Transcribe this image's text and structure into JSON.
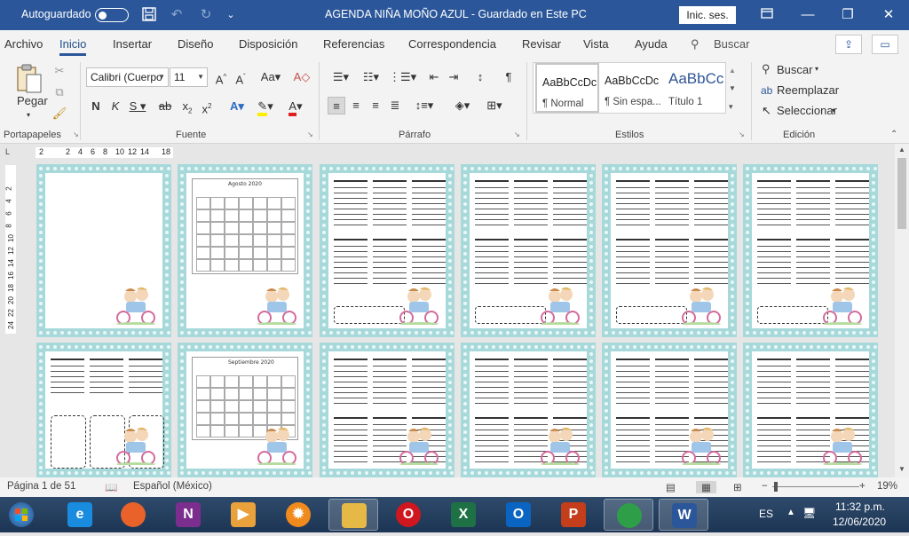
{
  "titlebar": {
    "autosave_label": "Autoguardado",
    "doc_title": "AGENDA NIÑA MOÑO AZUL  -  Guardado en Este PC",
    "signin": "Inic. ses.",
    "restore_icon": "ribbon-display-icon",
    "minimize": "—",
    "maximize": "❐",
    "close": "✕"
  },
  "menu": {
    "tabs": [
      "Archivo",
      "Inicio",
      "Insertar",
      "Diseño",
      "Disposición",
      "Referencias",
      "Correspondencia",
      "Revisar",
      "Vista",
      "Ayuda"
    ],
    "search_placeholder": "Buscar"
  },
  "ribbon": {
    "clipboard": {
      "paste": "Pegar",
      "label": "Portapapeles"
    },
    "font": {
      "family": "Calibri (Cuerpo",
      "size": "11",
      "label": "Fuente"
    },
    "paragraph": {
      "label": "Párrafo"
    },
    "styles": {
      "label": "Estilos",
      "items": [
        {
          "preview": "AaBbCcDc",
          "name": "¶ Normal"
        },
        {
          "preview": "AaBbCcDc",
          "name": "¶ Sin espa..."
        },
        {
          "preview": "AaBbCc",
          "name": "Título 1"
        }
      ]
    },
    "editing": {
      "label": "Edición",
      "find": "Buscar",
      "replace": "Reemplazar",
      "select": "Seleccionar"
    }
  },
  "ruler": {
    "h_ticks": [
      "2",
      "2",
      "4",
      "6",
      "8",
      "10",
      "12",
      "14",
      "18"
    ],
    "v_ticks": [
      "2",
      "4",
      "6",
      "8",
      "10",
      "12",
      "14",
      "16",
      "18",
      "20",
      "22",
      "24"
    ]
  },
  "pages": {
    "cal1_title": "Agosto 2020",
    "cal2_title": "Septiembre 2020",
    "day_numbers_row1": [
      [
        "01",
        "02",
        "03"
      ],
      [
        "07",
        "08",
        "09"
      ],
      [
        "13",
        "16",
        "17"
      ],
      [
        "22",
        "23",
        "24"
      ]
    ],
    "day_numbers_row1b": [
      [
        "04",
        "05",
        "06"
      ],
      [
        "11",
        "12",
        "13"
      ],
      [
        "18",
        "19",
        "20"
      ],
      [
        "25",
        "26",
        "27"
      ]
    ],
    "day_numbers_row2": [
      [
        "29",
        "30",
        "31"
      ]
    ]
  },
  "status": {
    "page": "Página 1 de 51",
    "language": "Español (México)",
    "zoom": "19%"
  },
  "taskbar": {
    "lang": "ES",
    "time": "11:32 p.m.",
    "date": "12/06/2020",
    "apps": [
      {
        "name": "start-button",
        "letter": ""
      },
      {
        "name": "internet-explorer",
        "letter": "e",
        "color": "#1a8ce0"
      },
      {
        "name": "firefox",
        "letter": "",
        "color": "#e8622a"
      },
      {
        "name": "onenote",
        "letter": "N",
        "color": "#7b2e8e"
      },
      {
        "name": "media-player",
        "letter": "▶",
        "color": "#e9a23b"
      },
      {
        "name": "settings-app",
        "letter": "✹",
        "color": "#f08a1c"
      },
      {
        "name": "file-explorer",
        "letter": "",
        "color": "#e6b846"
      },
      {
        "name": "opera",
        "letter": "O",
        "color": "#d0161e"
      },
      {
        "name": "excel",
        "letter": "X",
        "color": "#1e7145"
      },
      {
        "name": "outlook",
        "letter": "O",
        "color": "#0a64c2"
      },
      {
        "name": "powerpoint",
        "letter": "P",
        "color": "#c43e1c"
      },
      {
        "name": "chrome",
        "letter": "",
        "color": "#2e9e48"
      },
      {
        "name": "word",
        "letter": "W",
        "color": "#2b579a"
      }
    ]
  }
}
